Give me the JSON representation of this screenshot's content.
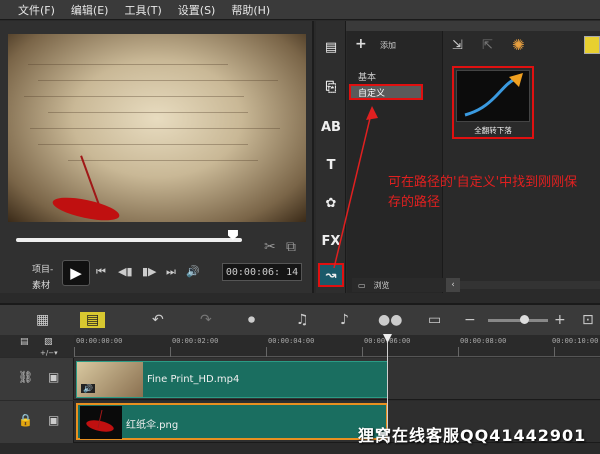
{
  "menu": [
    "文件(F)",
    "编辑(E)",
    "工具(T)",
    "设置(S)",
    "帮助(H)"
  ],
  "player": {
    "mode_project": "项目-",
    "mode_clip": "素材",
    "timecode": "00:00:06: 14",
    "progress": 0.96
  },
  "library": {
    "add_label": "添加",
    "categories": [
      "基本",
      "自定义"
    ],
    "selected_category": "自定义",
    "item_label": "全翻转下落",
    "browse_label": "浏览"
  },
  "annotation": "可在路径的'自定义'中找到刚刚保存的路径",
  "timeline": {
    "ruler": [
      "00:00:00:00",
      "00:00:02:00",
      "00:00:04:00",
      "00:00:06:00",
      "00:00:08:00",
      "00:00:10:00"
    ],
    "clips": [
      {
        "name": "Fine Print_HD.mp4"
      },
      {
        "name": "红纸伞.png"
      }
    ]
  },
  "watermark": "狸窝在线客服QQ41442901",
  "colors": {
    "annotation": "#e02020",
    "clip": "#1a6e60",
    "selected_clip_border": "#e89020"
  }
}
